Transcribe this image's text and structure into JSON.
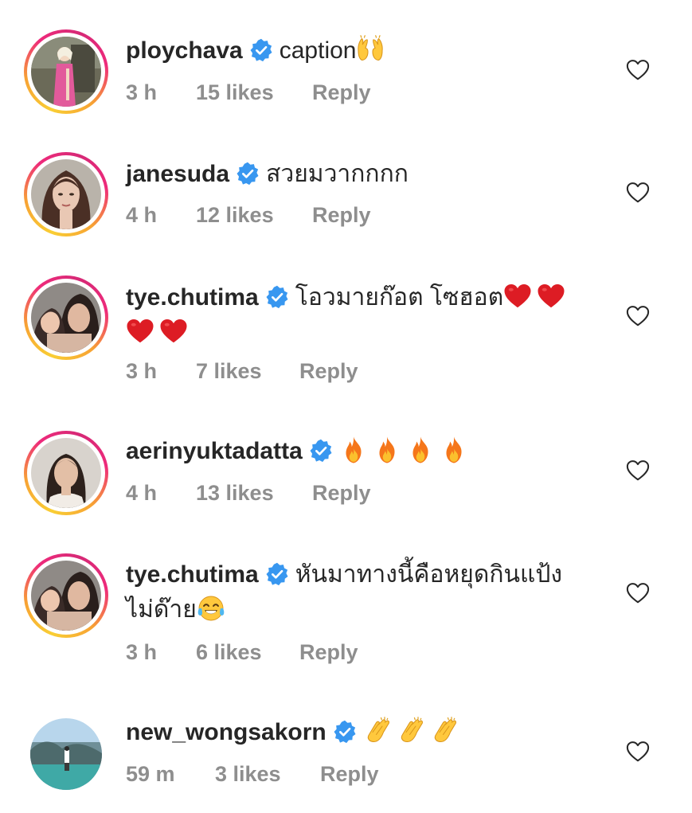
{
  "comments": [
    {
      "username": "ploychava",
      "verified": true,
      "text": "caption",
      "emojis": [
        "raising-hands"
      ],
      "time": "3 h",
      "likes": "15 likes",
      "reply": "Reply",
      "story_ring": true
    },
    {
      "username": "janesuda",
      "verified": true,
      "text": "สวยมวากกกก",
      "emojis": [],
      "time": "4 h",
      "likes": "12 likes",
      "reply": "Reply",
      "story_ring": true
    },
    {
      "username": "tye.chutima",
      "verified": true,
      "text": "โอวมายก๊อต โซฮอต",
      "emojis": [
        "red-heart",
        "red-heart",
        "red-heart",
        "red-heart"
      ],
      "time": "3 h",
      "likes": "7 likes",
      "reply": "Reply",
      "story_ring": true
    },
    {
      "username": "aerinyuktadatta",
      "verified": true,
      "text": "",
      "emojis": [
        "fire",
        "fire",
        "fire",
        "fire"
      ],
      "time": "4 h",
      "likes": "13 likes",
      "reply": "Reply",
      "story_ring": true
    },
    {
      "username": "tye.chutima",
      "verified": true,
      "text": "หันมาทางนี้คือหยุดกินแป้ง",
      "text_line2": "ไม่ด๊าย",
      "emojis": [
        "face-with-tears-of-joy"
      ],
      "time": "3 h",
      "likes": "6 likes",
      "reply": "Reply",
      "story_ring": true
    },
    {
      "username": "new_wongsakorn",
      "verified": true,
      "text": "",
      "emojis": [
        "clapping-hands",
        "clapping-hands",
        "clapping-hands"
      ],
      "time": "59 m",
      "likes": "3 likes",
      "reply": "Reply",
      "story_ring": false
    }
  ],
  "colors": {
    "text": "#262626",
    "meta": "#8e8e8e",
    "verified_blue": "#3897f0",
    "heart_outline": "#8e8e8e",
    "ring_gradient": [
      "#f9ce34",
      "#ee2a7b"
    ]
  },
  "icons": {
    "like": "heart-outline-icon",
    "verified": "verified-badge-icon"
  }
}
